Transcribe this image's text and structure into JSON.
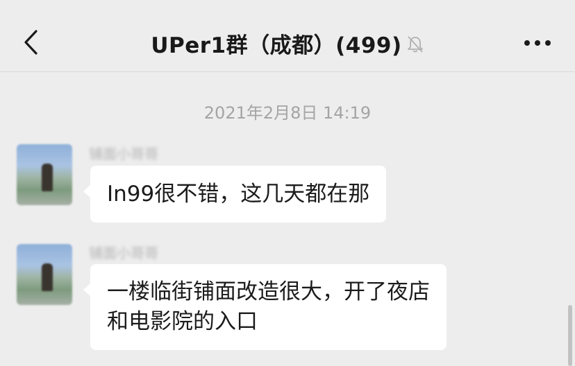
{
  "header": {
    "title": "UPer1群（成都）(499)",
    "back_icon": "chevron-left-icon",
    "mute_icon": "bell-muted-icon",
    "more_icon": "more-dots-icon"
  },
  "timestamp": "2021年2月8日 14:19",
  "messages": [
    {
      "sender": "铺面小哥哥",
      "text": "In99很不错，这几天都在那"
    },
    {
      "sender": "铺面小哥哥",
      "lines": [
        "一楼临街铺面改造很大，开了夜店",
        "和电影院的入口"
      ]
    }
  ],
  "colors": {
    "background": "#ededed",
    "bubble": "#ffffff",
    "timestamp": "#a4a4a4"
  }
}
